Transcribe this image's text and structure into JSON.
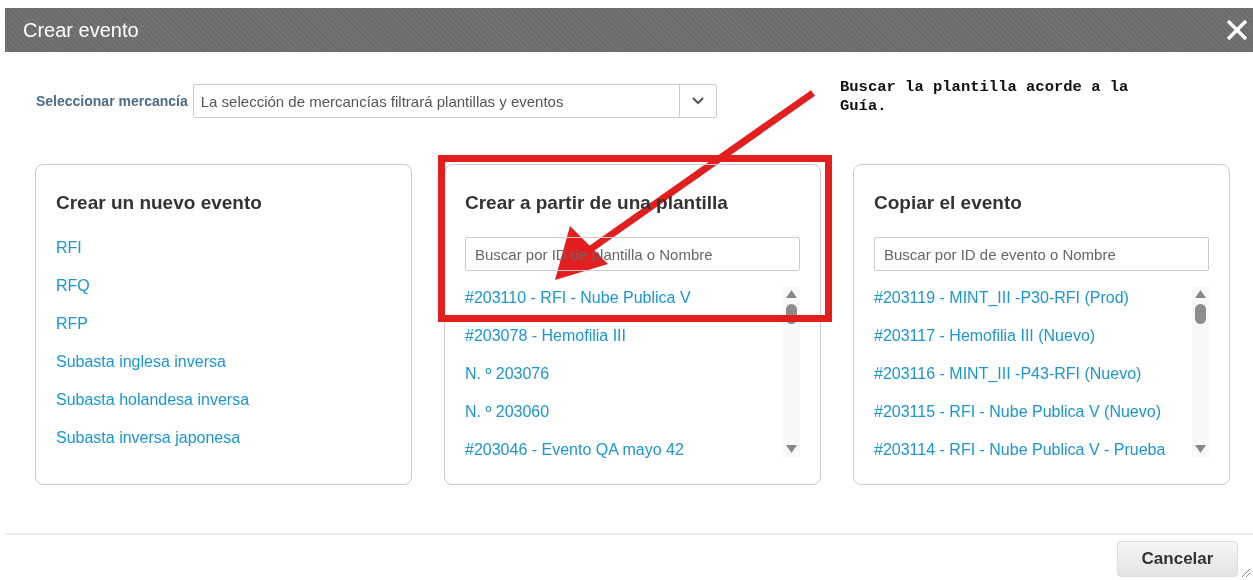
{
  "window": {
    "title": "Crear evento"
  },
  "commodity": {
    "label": "Seleccionar mercancía",
    "placeholder": "La selección de mercancías filtrará plantillas y eventos"
  },
  "annotation": {
    "text": "Buscar la plantilla acorde a la Guía."
  },
  "panels": [
    {
      "kind": "links",
      "title": "Crear un nuevo evento",
      "items": [
        "RFI",
        "RFQ",
        "RFP",
        "Subasta inglesa inversa",
        "Subasta holandesa inversa",
        "Subasta inversa japonesa"
      ]
    },
    {
      "kind": "search",
      "title": "Crear a partir de una plantilla",
      "placeholder": "Buscar por ID de plantilla o Nombre",
      "highlighted": true,
      "items": [
        "#203110 - RFI - Nube Publica V",
        "#203078 - Hemofilia III",
        "N. º 203076",
        "N. º 203060",
        "#203046 - Evento QA mayo 42"
      ]
    },
    {
      "kind": "search",
      "title": "Copiar el evento",
      "placeholder": "Buscar por ID de evento o Nombre",
      "highlighted": false,
      "items": [
        "#203119 - MINT_III -P30-RFI (Prod)",
        "#203117 - Hemofilia III (Nuevo)",
        "#203116 - MINT_III -P43-RFI (Nuevo)",
        "#203115 - RFI - Nube Publica V (Nuevo)",
        "#203114 - RFI - Nube Publica V - Prueba"
      ]
    }
  ],
  "footer": {
    "cancel": "Cancelar"
  }
}
